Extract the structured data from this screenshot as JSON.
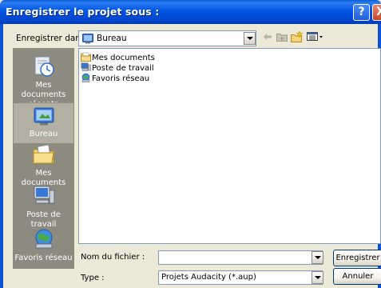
{
  "window": {
    "title": "Enregistrer le projet sous :"
  },
  "titlebar_buttons": {
    "help": "?",
    "close": "X"
  },
  "lookin": {
    "label": "Enregistrer dans :",
    "value": "Bureau"
  },
  "places": [
    {
      "label": "Mes documents récents",
      "icon": "recent-documents-icon"
    },
    {
      "label": "Bureau",
      "icon": "desktop-icon"
    },
    {
      "label": "Mes documents",
      "icon": "my-documents-icon"
    },
    {
      "label": "Poste de travail",
      "icon": "my-computer-icon"
    },
    {
      "label": "Favoris réseau",
      "icon": "network-places-icon"
    }
  ],
  "files": [
    {
      "name": "Mes documents",
      "icon": "folder-icon"
    },
    {
      "name": "Poste de travail",
      "icon": "computer-icon"
    },
    {
      "name": "Favoris réseau",
      "icon": "network-icon"
    }
  ],
  "filename": {
    "label": "Nom du fichier :",
    "value": ""
  },
  "filetype": {
    "label": "Type :",
    "value": "Projets Audacity (*.aup)"
  },
  "buttons": {
    "save": "Enregistrer",
    "cancel": "Annuler"
  }
}
